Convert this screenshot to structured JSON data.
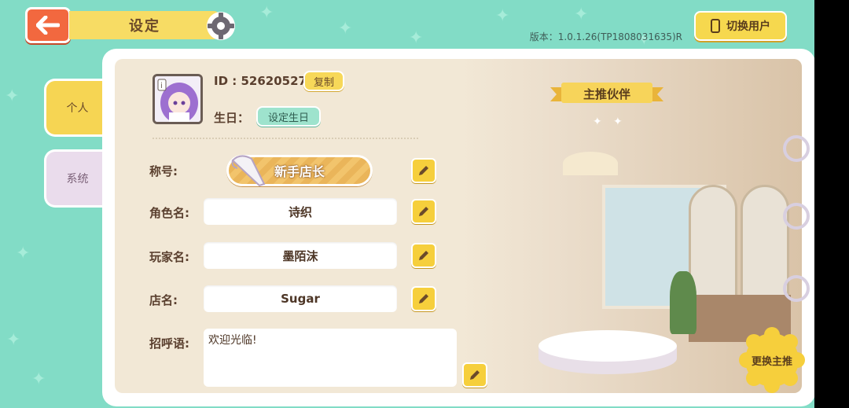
{
  "header": {
    "title": "设定",
    "version": "版本：1.0.1.26(TP1808031635)R",
    "switch_user_label": "切换用户"
  },
  "sidebar": {
    "tabs": [
      {
        "label": "个人",
        "active": true
      },
      {
        "label": "系统",
        "active": false
      }
    ]
  },
  "profile": {
    "id_text": "ID : 52620527",
    "copy_label": "复制",
    "birthday_label": "生日：",
    "set_birthday_label": "设定生日"
  },
  "fields": {
    "title_label": "称号:",
    "title_value": "新手店长",
    "role_label": "角色名:",
    "role_value": "诗织",
    "player_label": "玩家名:",
    "player_value": "墨陌沫",
    "shop_label": "店名:",
    "shop_value": "Sugar",
    "greeting_label": "招呼语:",
    "greeting_value": "欢迎光临!"
  },
  "partner": {
    "ribbon_label": "主推伙伴",
    "change_label": "更换主推"
  },
  "colors": {
    "background": "#82dcc6",
    "accent_yellow": "#f6d553",
    "back_red": "#f2683f"
  },
  "icons": [
    "back-arrow-icon",
    "gear-icon",
    "phone-icon",
    "edit-pencil-icon",
    "piping-bag-icon",
    "sparkle-icon"
  ]
}
